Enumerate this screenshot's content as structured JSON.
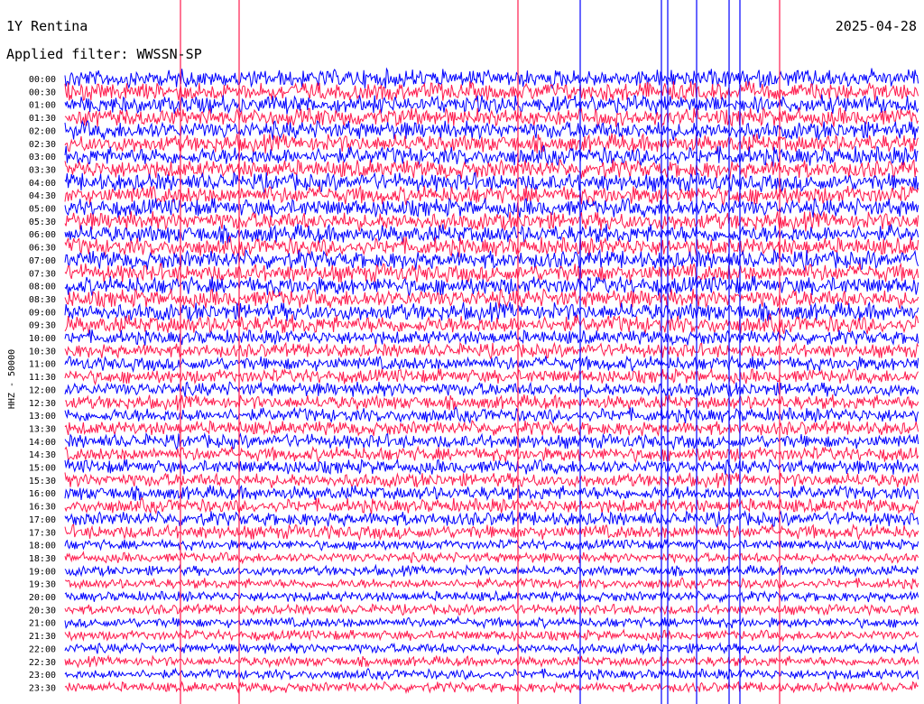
{
  "header": {
    "station": "1Y Rentina",
    "date": "2025-04-28",
    "filter": "Applied filter: WWSSN-SP"
  },
  "chart_data": {
    "type": "line",
    "ylabel": "HHZ - 50000",
    "row_labels": [
      "00:00",
      "00:30",
      "01:00",
      "01:30",
      "02:00",
      "02:30",
      "03:00",
      "03:30",
      "04:00",
      "04:30",
      "05:00",
      "05:30",
      "06:00",
      "06:30",
      "07:00",
      "07:30",
      "08:00",
      "08:30",
      "09:00",
      "09:30",
      "10:00",
      "10:30",
      "11:00",
      "11:30",
      "12:00",
      "12:30",
      "13:00",
      "13:30",
      "14:00",
      "14:30",
      "15:00",
      "15:30",
      "16:00",
      "16:30",
      "17:00",
      "17:30",
      "18:00",
      "18:30",
      "19:00",
      "19:30",
      "20:00",
      "20:30",
      "21:00",
      "21:30",
      "22:00",
      "22:30",
      "23:00",
      "23:30"
    ],
    "series_colors": [
      "#0000ff",
      "#ff1a4d"
    ],
    "row_duration_minutes": 30
  }
}
